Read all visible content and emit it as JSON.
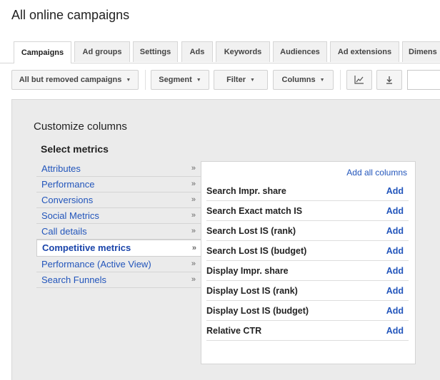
{
  "page": {
    "title": "All online campaigns"
  },
  "tabs": [
    {
      "label": "Campaigns",
      "active": true
    },
    {
      "label": "Ad groups"
    },
    {
      "label": "Settings"
    },
    {
      "label": "Ads"
    },
    {
      "label": "Keywords"
    },
    {
      "label": "Audiences"
    },
    {
      "label": "Ad extensions"
    },
    {
      "label": "Dimens"
    }
  ],
  "toolbar": {
    "campaign_filter": "All but removed campaigns",
    "segment": "Segment",
    "filter": "Filter",
    "columns": "Columns",
    "chart_icon": "line-chart-icon",
    "download_icon": "download-icon",
    "search_value": ""
  },
  "customize": {
    "title": "Customize columns",
    "subtitle": "Select metrics",
    "categories": [
      {
        "label": "Attributes"
      },
      {
        "label": "Performance"
      },
      {
        "label": "Conversions"
      },
      {
        "label": "Social Metrics"
      },
      {
        "label": "Call details"
      },
      {
        "label": "Competitive metrics",
        "active": true
      },
      {
        "label": "Performance (Active View)"
      },
      {
        "label": "Search Funnels"
      }
    ],
    "chevron": "»",
    "add_all": "Add all columns",
    "add_label": "Add",
    "metrics": [
      "Search Impr. share",
      "Search Exact match IS",
      "Search Lost IS (rank)",
      "Search Lost IS (budget)",
      "Display Impr. share",
      "Display Lost IS (rank)",
      "Display Lost IS (budget)",
      "Relative CTR"
    ]
  },
  "colors": {
    "link": "#2255bb",
    "panel_bg": "#ebebeb",
    "tab_bg": "#f1f1f1"
  }
}
